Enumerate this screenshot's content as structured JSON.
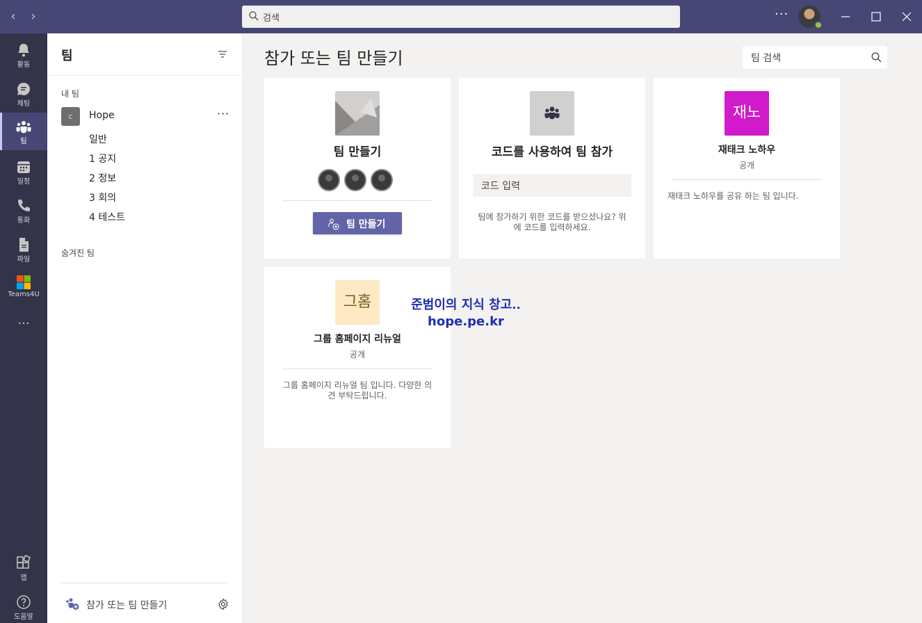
{
  "titlebar": {
    "search_placeholder": "검색",
    "more": "···",
    "status_color": "#92c353"
  },
  "rail": [
    {
      "label": "활동",
      "icon": "bell-icon"
    },
    {
      "label": "채팅",
      "icon": "chat-icon"
    },
    {
      "label": "팀",
      "icon": "teams-icon",
      "active": true
    },
    {
      "label": "일정",
      "icon": "calendar-icon"
    },
    {
      "label": "통화",
      "icon": "phone-icon"
    },
    {
      "label": "파일",
      "icon": "file-icon"
    },
    {
      "label": "Teams4U",
      "icon": "teams4u-logo-icon"
    },
    {
      "label": "앱",
      "icon": "apps-icon"
    },
    {
      "label": "도움말",
      "icon": "help-icon"
    }
  ],
  "rail_more": "···",
  "pane": {
    "title": "팀",
    "my_teams_label": "내 팀",
    "team": {
      "initial": "c",
      "name": "Hope",
      "more": "···"
    },
    "channels": [
      "일반",
      "1 공지",
      "2 정보",
      "3 회의",
      "4 테스트"
    ],
    "hidden_teams_label": "숨겨진 팀",
    "join_create_label": "참가 또는 팀 만들기"
  },
  "main": {
    "title": "참가 또는 팀 만들기",
    "search_placeholder": "팀 검색",
    "create_card": {
      "title": "팀 만들기",
      "button": "팀 만들기"
    },
    "code_card": {
      "title": "코드를 사용하여 팀 참가",
      "input_placeholder": "코드 입력",
      "desc_line1": "팀에 참가하기 위한 코드를 받으셨나요? 위",
      "desc_line2": "에 코드를 입력하세요."
    },
    "team_cards": [
      {
        "tile": "재노",
        "tile_bg": "#d11ac9",
        "tile_color": "#ffffff",
        "name": "재태크 노하우",
        "visibility": "공개",
        "desc_line1": "재태크 노하우를 공유 하는 팀 입니다.",
        "desc_line2": ""
      },
      {
        "tile": "그홈",
        "tile_bg": "#fde9c4",
        "tile_color": "#7a5a1e",
        "name": "그룹 홈페이지 리뉴얼",
        "visibility": "공개",
        "desc_line1": "그룹 홈페이지 리뉴얼 팀 입니다. 다양한 의",
        "desc_line2": "견 부탁드립니다."
      }
    ]
  },
  "watermark": {
    "line1": "준범이의 지식 창고..",
    "line2": "hope.pe.kr"
  }
}
